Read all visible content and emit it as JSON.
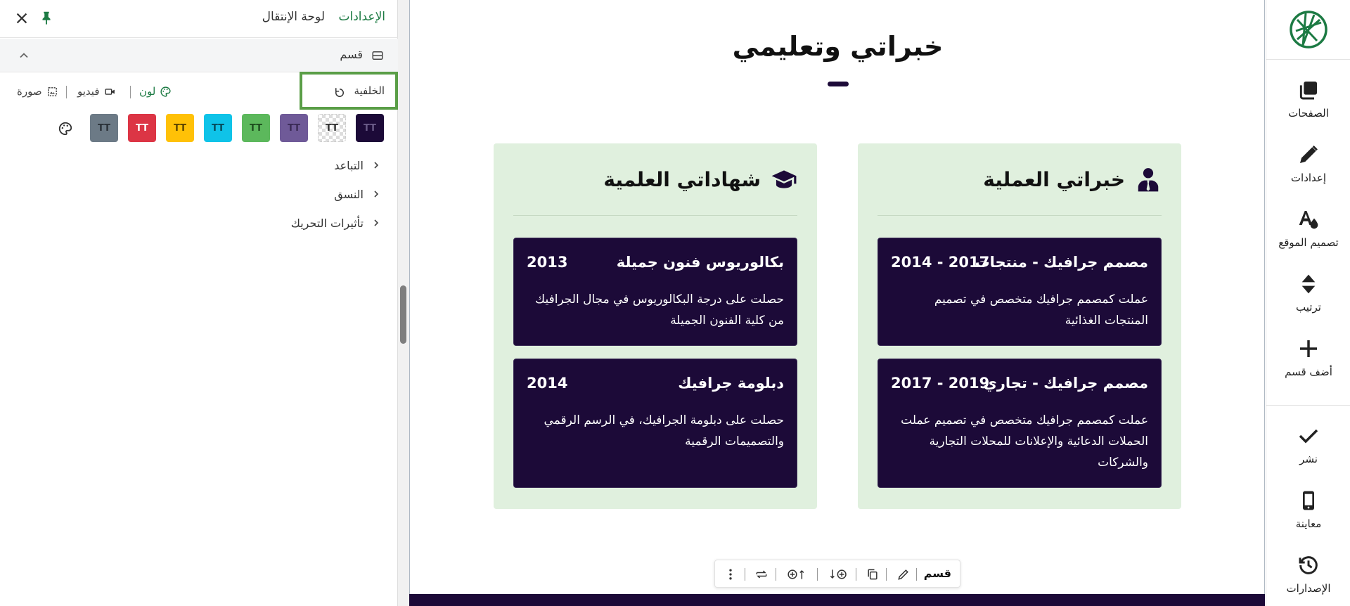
{
  "sidebar": {
    "items": [
      {
        "label": "الصفحات",
        "icon": "pages-icon"
      },
      {
        "label": "إعدادات",
        "icon": "pencil-icon"
      },
      {
        "label": "تصميم الموقع",
        "icon": "site-design-icon"
      },
      {
        "label": "ترتيب",
        "icon": "reorder-icon"
      },
      {
        "label": "أضف قسم",
        "icon": "plus-icon"
      },
      {
        "label": "نشر",
        "icon": "check-icon"
      },
      {
        "label": "معاينة",
        "icon": "mobile-icon"
      },
      {
        "label": "الإصدارات",
        "icon": "history-icon"
      }
    ]
  },
  "panel": {
    "tab_settings": "الإعدادات",
    "tab_navigation": "لوحة الإنتقال",
    "section_title": "قسم",
    "background_label": "الخلفية",
    "color_option": "لون",
    "video_option": "فيديو",
    "image_option": "صورة",
    "swatch_text": "TT",
    "swatches": [
      "#1c0a38",
      "checker",
      "#6f5a98",
      "#5cb85c",
      "#0fc3e8",
      "#ffc107",
      "#dc3545",
      "#6c7a86"
    ],
    "accordions": [
      "التباعد",
      "النسق",
      "تأثيرات التحريك"
    ]
  },
  "canvas": {
    "title": "خبراتي وتعليمي",
    "columns": [
      {
        "heading": "خبراتي العملية",
        "icon": "user-tie-icon",
        "cards": [
          {
            "title": "مصمم جرافيك - منتجات",
            "year": "2017 - 2014",
            "desc": "عملت كمصمم جرافيك متخصص في تصميم المنتجات الغذائية"
          },
          {
            "title": "مصمم جرافيك - تجاري",
            "year": "2019 - 2017",
            "desc": "عملت كمصمم جرافيك متخصص في تصميم عملت الحملات الدعائية والإعلانات للمحلات التجارية والشركات"
          }
        ]
      },
      {
        "heading": "شهاداتي العلمية",
        "icon": "graduation-cap-icon",
        "cards": [
          {
            "title": "بكالوريوس فنون جميلة",
            "year": "2013",
            "desc": "حصلت على درجة البكالوريوس في مجال الجرافيك من كلية الفنون الجميلة"
          },
          {
            "title": "دبلومة جرافيك",
            "year": "2014",
            "desc": "حصلت على دبلومة الجرافيك، في الرسم الرقمي والتصميمات الرقمية"
          }
        ]
      }
    ],
    "toolbar_label": "قسم"
  },
  "colors": {
    "accent": "#1c7a43",
    "dark": "#1c0a38",
    "column_bg": "#e0f0de",
    "highlight": "#5a9e47"
  }
}
